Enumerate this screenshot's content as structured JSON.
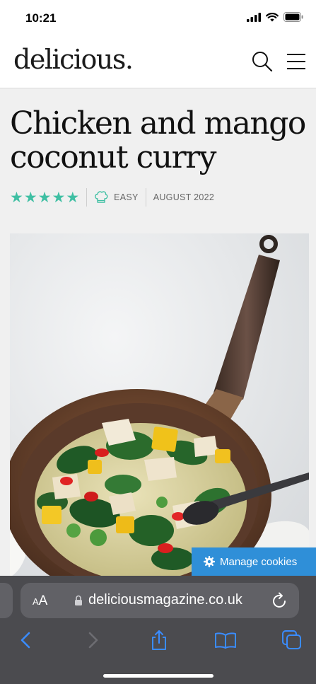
{
  "status_bar": {
    "time": "10:21"
  },
  "header": {
    "logo": "delicious."
  },
  "article": {
    "title": "Chicken and mango coconut curry",
    "rating": 5,
    "difficulty": "EASY",
    "date": "AUGUST 2022"
  },
  "cookie_button": {
    "label": "Manage cookies"
  },
  "browser": {
    "aa_small": "A",
    "aa_large": "A",
    "url": "deliciousmagazine.co.uk"
  },
  "colors": {
    "star": "#3fbfa3",
    "cookie_bg": "#2f8fd8",
    "safari_bg": "#4b4b4f"
  }
}
